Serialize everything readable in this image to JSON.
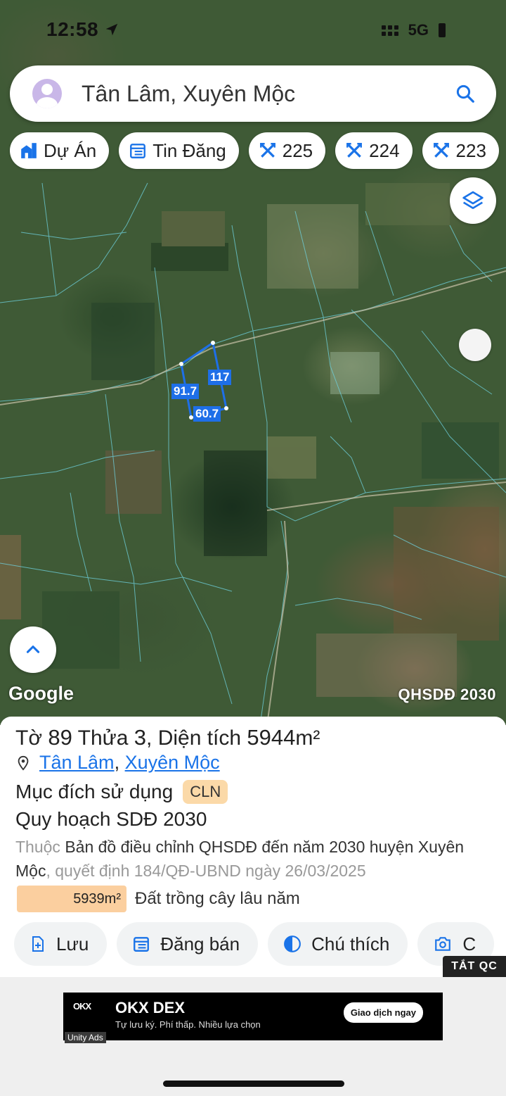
{
  "status_bar": {
    "time": "12:58",
    "network": "5G"
  },
  "search": {
    "query": "Tân Lâm, Xuyên Mộc"
  },
  "chips": [
    {
      "label": "Dự Án",
      "icon": "project-icon"
    },
    {
      "label": "Tin Đăng",
      "icon": "listing-icon"
    },
    {
      "label": "225",
      "icon": "parcel-icon"
    },
    {
      "label": "224",
      "icon": "parcel-icon"
    },
    {
      "label": "223",
      "icon": "parcel-icon"
    }
  ],
  "map": {
    "google_label": "Google",
    "overlay_tag": "QHSDĐ 2030",
    "dimensions": [
      "117",
      "91.7",
      "60.7"
    ]
  },
  "parcel": {
    "title_prefix": "Tờ",
    "sheet": "89",
    "plot_label": "Thửa",
    "plot": "3",
    "area_label": "Diện tích",
    "area": "5944",
    "area_unit": "m²",
    "commune": "Tân Lâm",
    "district": "Xuyên Mộc",
    "purpose_label": "Mục đích sử dụng",
    "purpose_code": "CLN",
    "plan_title": "Quy hoạch SDĐ 2030",
    "desc_prefix": "Thuộc",
    "desc_main": "Bản đồ điều chỉnh QHSDĐ đến năm 2030 huyện Xuyên Mộc",
    "desc_suffix": ", quyết định 184/QĐ-UBND ngày 26/03/2025",
    "zone_area": "5939m²",
    "zone_label": "Đất trồng cây lâu năm",
    "zone_color": "#fbcf9f"
  },
  "actions": [
    {
      "label": "Lưu",
      "icon": "save-icon"
    },
    {
      "label": "Đăng bán",
      "icon": "sell-icon"
    },
    {
      "label": "Chú thích",
      "icon": "legend-icon"
    },
    {
      "label": "C",
      "icon": "camera-icon"
    }
  ],
  "ad": {
    "close_label": "TẮT QC",
    "logo": "OKX",
    "brand": "OKX DEX",
    "subtitle": "Tự lưu ký. Phí thấp. Nhiều lựa chọn",
    "cta": "Giao dịch ngay",
    "network": "Unity Ads"
  },
  "colors": {
    "accent": "#1a73e8",
    "parcel_outline": "#1e6fe8",
    "cln_badge": "#fbd9a8"
  }
}
